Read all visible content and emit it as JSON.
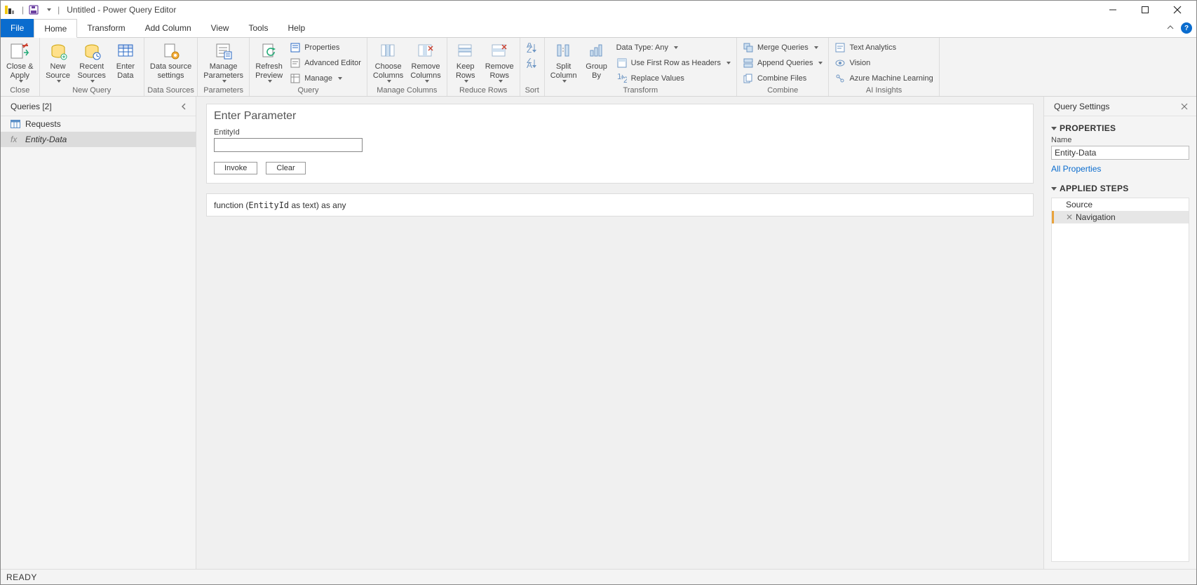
{
  "titlebar": {
    "title": "Untitled - Power Query Editor"
  },
  "tabs": {
    "file": "File",
    "home": "Home",
    "transform": "Transform",
    "addcolumn": "Add Column",
    "view": "View",
    "tools": "Tools",
    "help": "Help"
  },
  "ribbon": {
    "close": {
      "close_apply": "Close &\nApply",
      "group": "Close"
    },
    "newquery": {
      "new_source": "New\nSource",
      "recent_sources": "Recent\nSources",
      "enter_data": "Enter\nData",
      "group": "New Query"
    },
    "datasources": {
      "settings": "Data source\nsettings",
      "group": "Data Sources"
    },
    "parameters": {
      "manage": "Manage\nParameters",
      "group": "Parameters"
    },
    "query": {
      "refresh": "Refresh\nPreview",
      "properties": "Properties",
      "advanced": "Advanced Editor",
      "manage": "Manage",
      "group": "Query"
    },
    "managecols": {
      "choose": "Choose\nColumns",
      "remove": "Remove\nColumns",
      "group": "Manage Columns"
    },
    "reducerows": {
      "keep": "Keep\nRows",
      "remove": "Remove\nRows",
      "group": "Reduce Rows"
    },
    "sort": {
      "group": "Sort"
    },
    "transform": {
      "split": "Split\nColumn",
      "groupby": "Group\nBy",
      "datatype": "Data Type: Any",
      "firstrow": "Use First Row as Headers",
      "replace": "Replace Values",
      "group": "Transform"
    },
    "combine": {
      "merge": "Merge Queries",
      "append": "Append Queries",
      "files": "Combine Files",
      "group": "Combine"
    },
    "ai": {
      "text": "Text Analytics",
      "vision": "Vision",
      "ml": "Azure Machine Learning",
      "group": "AI Insights"
    }
  },
  "queries": {
    "header": "Queries [2]",
    "items": [
      {
        "name": "Requests",
        "type": "table"
      },
      {
        "name": "Entity-Data",
        "type": "function"
      }
    ]
  },
  "center": {
    "title": "Enter Parameter",
    "param_label": "EntityId",
    "invoke": "Invoke",
    "clear": "Clear",
    "signature_pre": "function (",
    "signature_mono": "EntityId",
    "signature_post": " as text) as any"
  },
  "settings": {
    "header": "Query Settings",
    "properties": "PROPERTIES",
    "name_label": "Name",
    "name_value": "Entity-Data",
    "all_props": "All Properties",
    "applied": "APPLIED STEPS",
    "steps": [
      "Source",
      "Navigation"
    ]
  },
  "status": "READY"
}
